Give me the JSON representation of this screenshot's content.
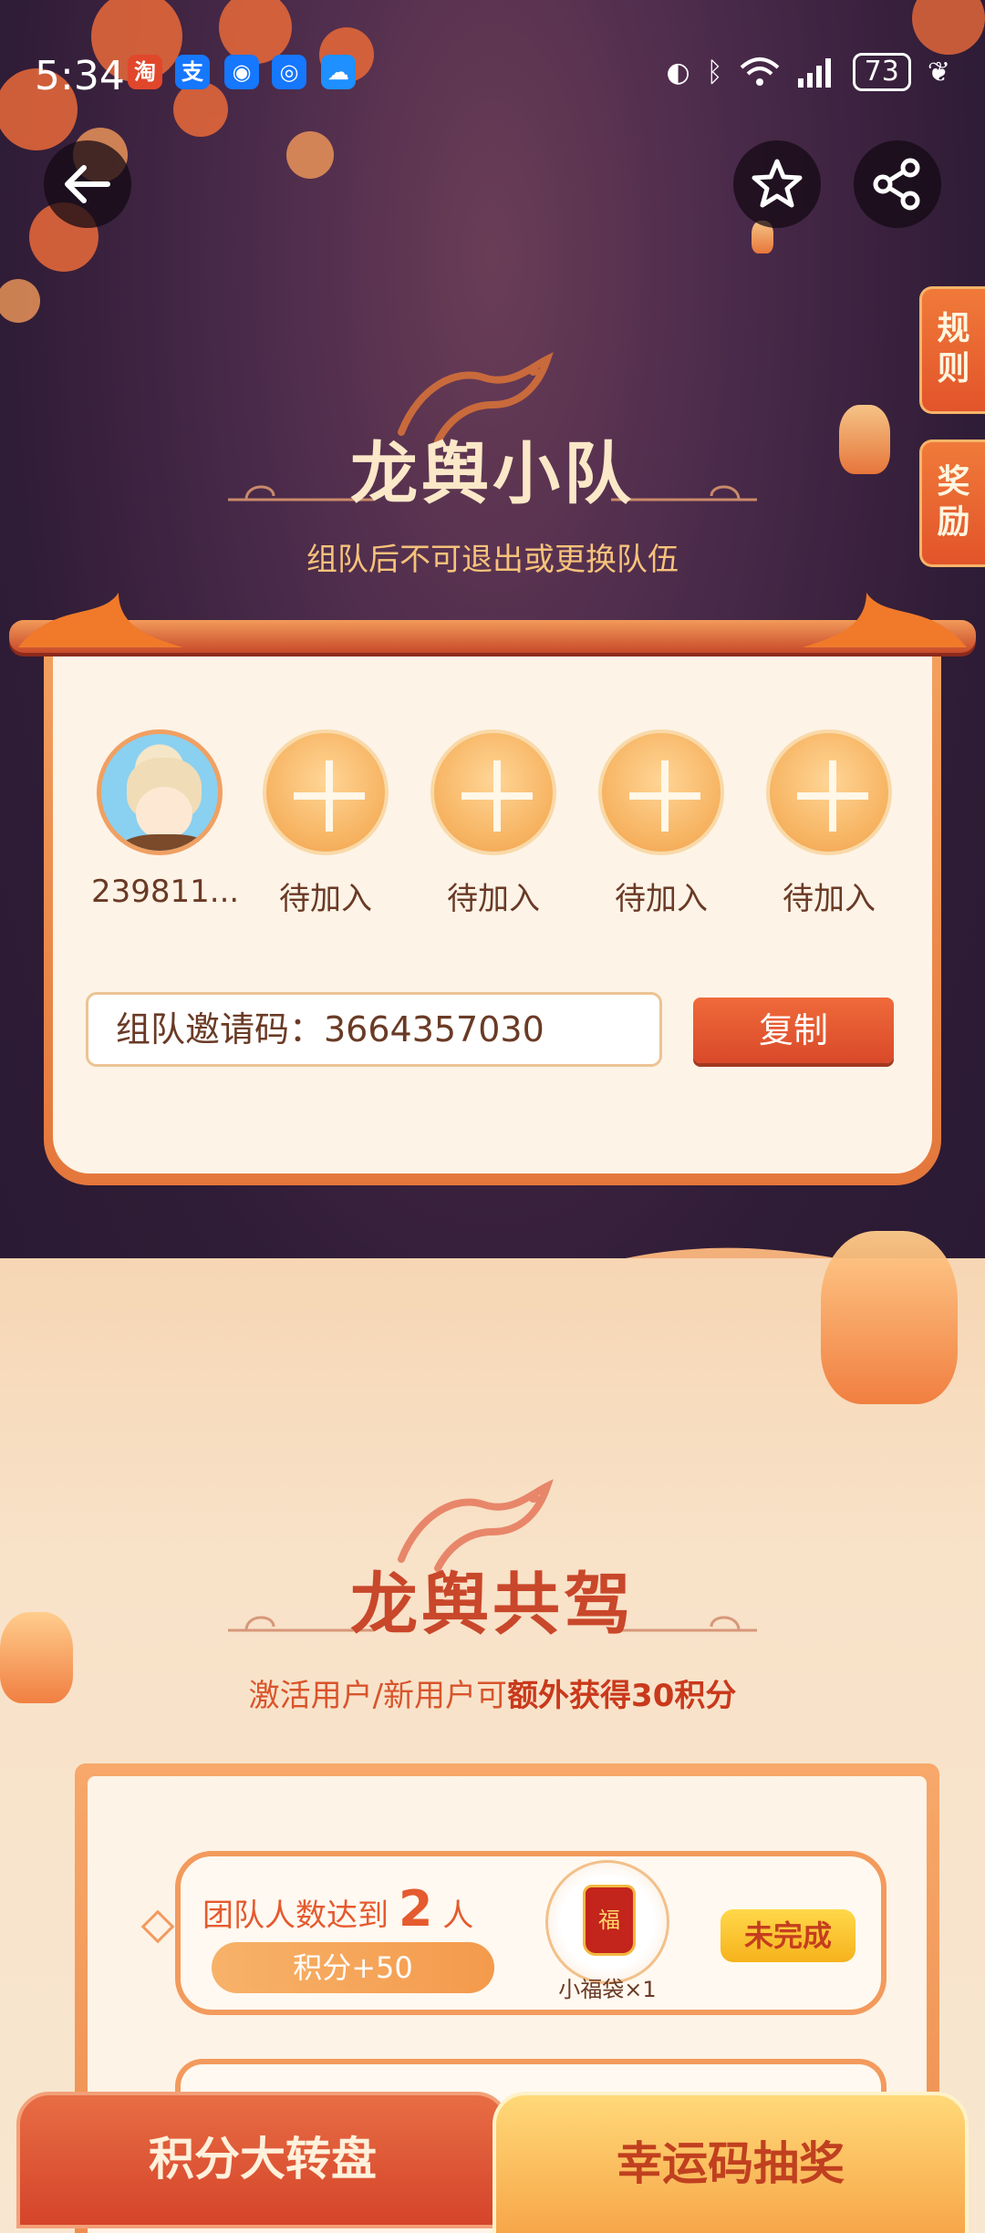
{
  "status_bar": {
    "time": "5:34",
    "app_icons": [
      "淘",
      "支",
      "◉",
      "◎",
      "☁"
    ],
    "battery": "73"
  },
  "header": {
    "back": "back-arrow-icon",
    "favorite": "star-icon",
    "share": "share-icon"
  },
  "side_tabs": {
    "rules": "规\n则",
    "rewards": "奖\n励"
  },
  "team": {
    "title": "龙舆小队",
    "subtitle": "组队后不可退出或更换队伍",
    "members": [
      {
        "name": "239811...",
        "joined": true
      },
      {
        "name": "待加入",
        "joined": false
      },
      {
        "name": "待加入",
        "joined": false
      },
      {
        "name": "待加入",
        "joined": false
      },
      {
        "name": "待加入",
        "joined": false
      }
    ],
    "invite_label": "组队邀请码：3664357030",
    "copy_label": "复制"
  },
  "ride": {
    "title": "龙舆共驾",
    "subtitle_prefix": "激活用户/新用户可",
    "subtitle_bold": "额外获得30积分",
    "task": {
      "text_prefix": "团队人数达到",
      "count": "2",
      "text_suffix": "人",
      "points": "积分+50",
      "prize_label": "小福袋×1",
      "bag_char": "福",
      "status": "未完成"
    }
  },
  "bottom_tabs": {
    "left": "积分大转盘",
    "right": "幸运码抽奖"
  },
  "colors": {
    "accent": "#e55a2e",
    "gold": "#f6b21c",
    "night": "#3a2040",
    "cream": "#fdf3e7"
  }
}
